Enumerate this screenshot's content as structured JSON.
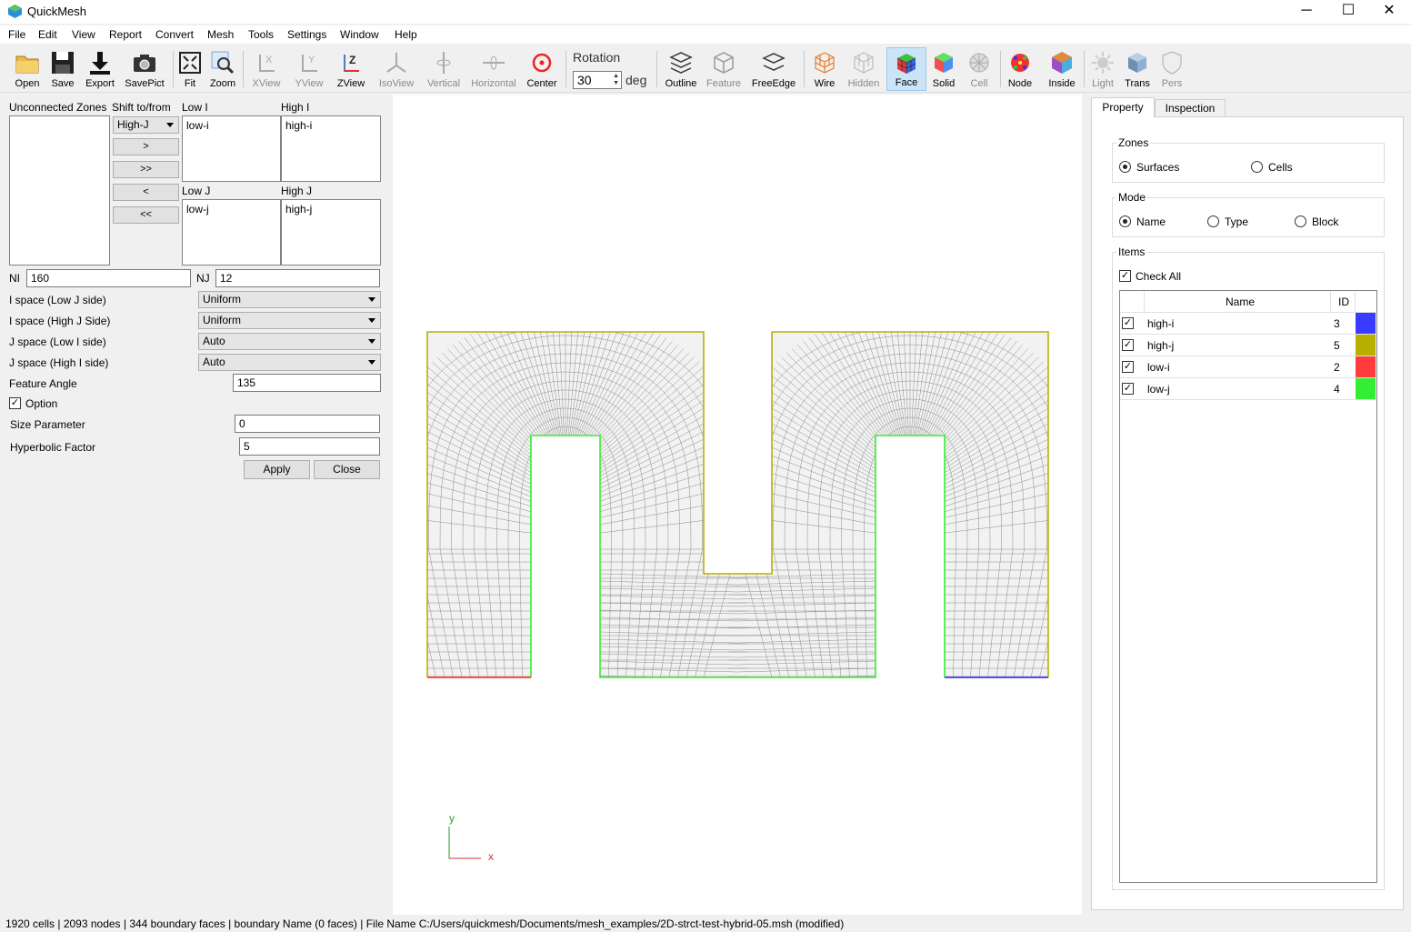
{
  "app": {
    "title": "QuickMesh",
    "minimize": "─",
    "maximize": "☐",
    "close": "✕"
  },
  "menu": [
    "File",
    "Edit",
    "View",
    "Report",
    "Convert",
    "Mesh",
    "Tools",
    "Settings",
    "Window",
    "Help"
  ],
  "toolbar": {
    "buttons": [
      {
        "label": "Open",
        "icon": "folder-icon"
      },
      {
        "label": "Save",
        "icon": "floppy-icon"
      },
      {
        "label": "Export",
        "icon": "download-icon"
      },
      {
        "label": "SavePict",
        "icon": "camera-icon"
      },
      {
        "label": "Fit",
        "icon": "fit-icon"
      },
      {
        "label": "Zoom",
        "icon": "zoom-icon"
      },
      {
        "label": "XView",
        "icon": "xview-icon"
      },
      {
        "label": "YView",
        "icon": "yview-icon"
      },
      {
        "label": "ZView",
        "icon": "zview-icon"
      },
      {
        "label": "IsoView",
        "icon": "isoview-icon"
      },
      {
        "label": "Vertical",
        "icon": "vertical-icon"
      },
      {
        "label": "Horizontal",
        "icon": "horizontal-icon"
      },
      {
        "label": "Center",
        "icon": "target-icon"
      },
      {
        "label": "Outline",
        "icon": "outline-icon"
      },
      {
        "label": "Feature",
        "icon": "feature-icon"
      },
      {
        "label": "FreeEdge",
        "icon": "freeedge-icon"
      },
      {
        "label": "Wire",
        "icon": "wire-icon"
      },
      {
        "label": "Hidden",
        "icon": "hidden-icon"
      },
      {
        "label": "Face",
        "icon": "face-icon"
      },
      {
        "label": "Solid",
        "icon": "solid-icon"
      },
      {
        "label": "Cell",
        "icon": "cell-icon"
      },
      {
        "label": "Node",
        "icon": "node-icon"
      },
      {
        "label": "Inside",
        "icon": "inside-icon"
      },
      {
        "label": "Light",
        "icon": "light-icon"
      },
      {
        "label": "Trans",
        "icon": "trans-icon"
      },
      {
        "label": "Pers",
        "icon": "pers-icon"
      }
    ],
    "rotation_label": "Rotation",
    "rotation_value": "30",
    "rotation_unit": "deg"
  },
  "left": {
    "unconnected_label": "Unconnected Zones",
    "shift_label": "Shift to/from",
    "shift_select": "High-J",
    "move_right": ">",
    "move_all_right": ">>",
    "move_left": "<",
    "move_all_left": "<<",
    "low_i_label": "Low I",
    "low_i_item": "low-i",
    "high_i_label": "High I",
    "high_i_item": "high-i",
    "low_j_label": "Low J",
    "low_j_item": "low-j",
    "high_j_label": "High J",
    "high_j_item": "high-j",
    "ni_label": "NI",
    "ni_value": "160",
    "nj_label": "NJ",
    "nj_value": "12",
    "ispace_low_label": "I space (Low J side)",
    "ispace_low_value": "Uniform",
    "ispace_high_label": "I space (High J Side)",
    "ispace_high_value": "Uniform",
    "jspace_low_label": "J space (Low I side)",
    "jspace_low_value": "Auto",
    "jspace_high_label": "J space (High I side)",
    "jspace_high_value": "Auto",
    "feature_angle_label": "Feature Angle",
    "feature_angle_value": "135",
    "option_label": "Option",
    "size_param_label": "Size Parameter",
    "size_param_value": "0",
    "hyperbolic_label": "Hyperbolic Factor",
    "hyperbolic_value": "5",
    "apply": "Apply",
    "close": "Close"
  },
  "axis": {
    "y": "y",
    "x": "x"
  },
  "right": {
    "tabs": [
      "Property",
      "Inspection"
    ],
    "zones_title": "Zones",
    "zones_options": [
      "Surfaces",
      "Cells"
    ],
    "mode_title": "Mode",
    "mode_options": [
      "Name",
      "Type",
      "Block"
    ],
    "items_title": "Items",
    "check_all": "Check All",
    "col_name": "Name",
    "col_id": "ID",
    "items": [
      {
        "name": "high-i",
        "id": "3",
        "color": "#3b3bff"
      },
      {
        "name": "high-j",
        "id": "5",
        "color": "#b8b000"
      },
      {
        "name": "low-i",
        "id": "2",
        "color": "#ff3b3b"
      },
      {
        "name": "low-j",
        "id": "4",
        "color": "#33ee33"
      }
    ]
  },
  "status": "1920 cells | 2093 nodes | 344 boundary faces |  boundary Name  (0 faces) | File Name C:/Users/quickmesh/Documents/mesh_examples/2D-strct-test-hybrid-05.msh (modified)"
}
